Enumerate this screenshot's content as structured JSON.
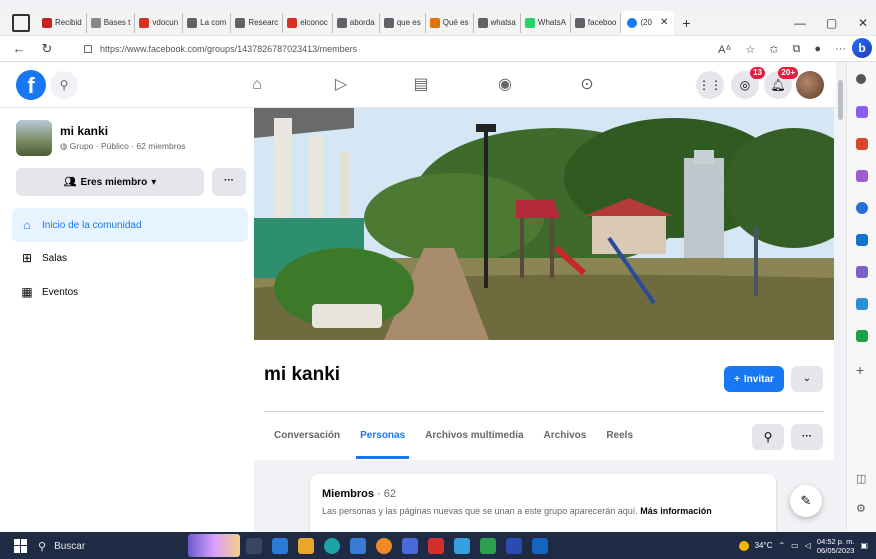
{
  "browser": {
    "tabs": [
      {
        "label": "Recibid",
        "color": "#c5221f"
      },
      {
        "label": "Bases t",
        "color": "#888888"
      },
      {
        "label": "vdocun",
        "color": "#d93025"
      },
      {
        "label": "La com",
        "color": "#5f6368"
      },
      {
        "label": "Researc",
        "color": "#5f6368"
      },
      {
        "label": "elconoc",
        "color": "#d93025"
      },
      {
        "label": "aborda",
        "color": "#5f6368"
      },
      {
        "label": "que es",
        "color": "#5f6368"
      },
      {
        "label": "Qué es",
        "color": "#e37400"
      },
      {
        "label": "whatsa",
        "color": "#5f6368"
      },
      {
        "label": "WhatsA",
        "color": "#25d366"
      },
      {
        "label": "faceboo",
        "color": "#5f6368"
      }
    ],
    "active_tab": {
      "label": "(20",
      "color": "#1877f2"
    },
    "url": "https://www.facebook.com/groups/1437826787023413/members",
    "win_min": "—",
    "win_max": "▢",
    "win_close": "✕"
  },
  "fb_nav": {
    "logo": "f",
    "messenger_badge": "13",
    "notif_badge": "20+"
  },
  "group": {
    "name": "mi kanki",
    "meta": "Grupo · Público · 62 miembros",
    "member_button": "Eres miembro",
    "more_button": "···",
    "title": "mi kanki",
    "invite_button": "Invitar"
  },
  "sidebar": {
    "items": [
      {
        "label": "Inicio de la comunidad",
        "icon": "home-icon"
      },
      {
        "label": "Salas",
        "icon": "rooms-icon"
      },
      {
        "label": "Eventos",
        "icon": "calendar-icon"
      }
    ]
  },
  "tabs": [
    {
      "label": "Conversación"
    },
    {
      "label": "Personas"
    },
    {
      "label": "Archivos multimedia"
    },
    {
      "label": "Archivos"
    },
    {
      "label": "Reels"
    }
  ],
  "members": {
    "title": "Miembros",
    "count": "· 62",
    "desc": "Las personas y las páginas nuevas que se unan a este grupo aparecerán aquí.",
    "more_info": "Más información"
  },
  "taskbar": {
    "search_label": "Buscar",
    "temperature": "34°C",
    "time": "04:52 p. m.",
    "date": "06/05/2023"
  },
  "colors": {
    "fb_blue": "#1877f2",
    "badge_red": "#e41e3f",
    "taskbar": "#1f2a44"
  }
}
